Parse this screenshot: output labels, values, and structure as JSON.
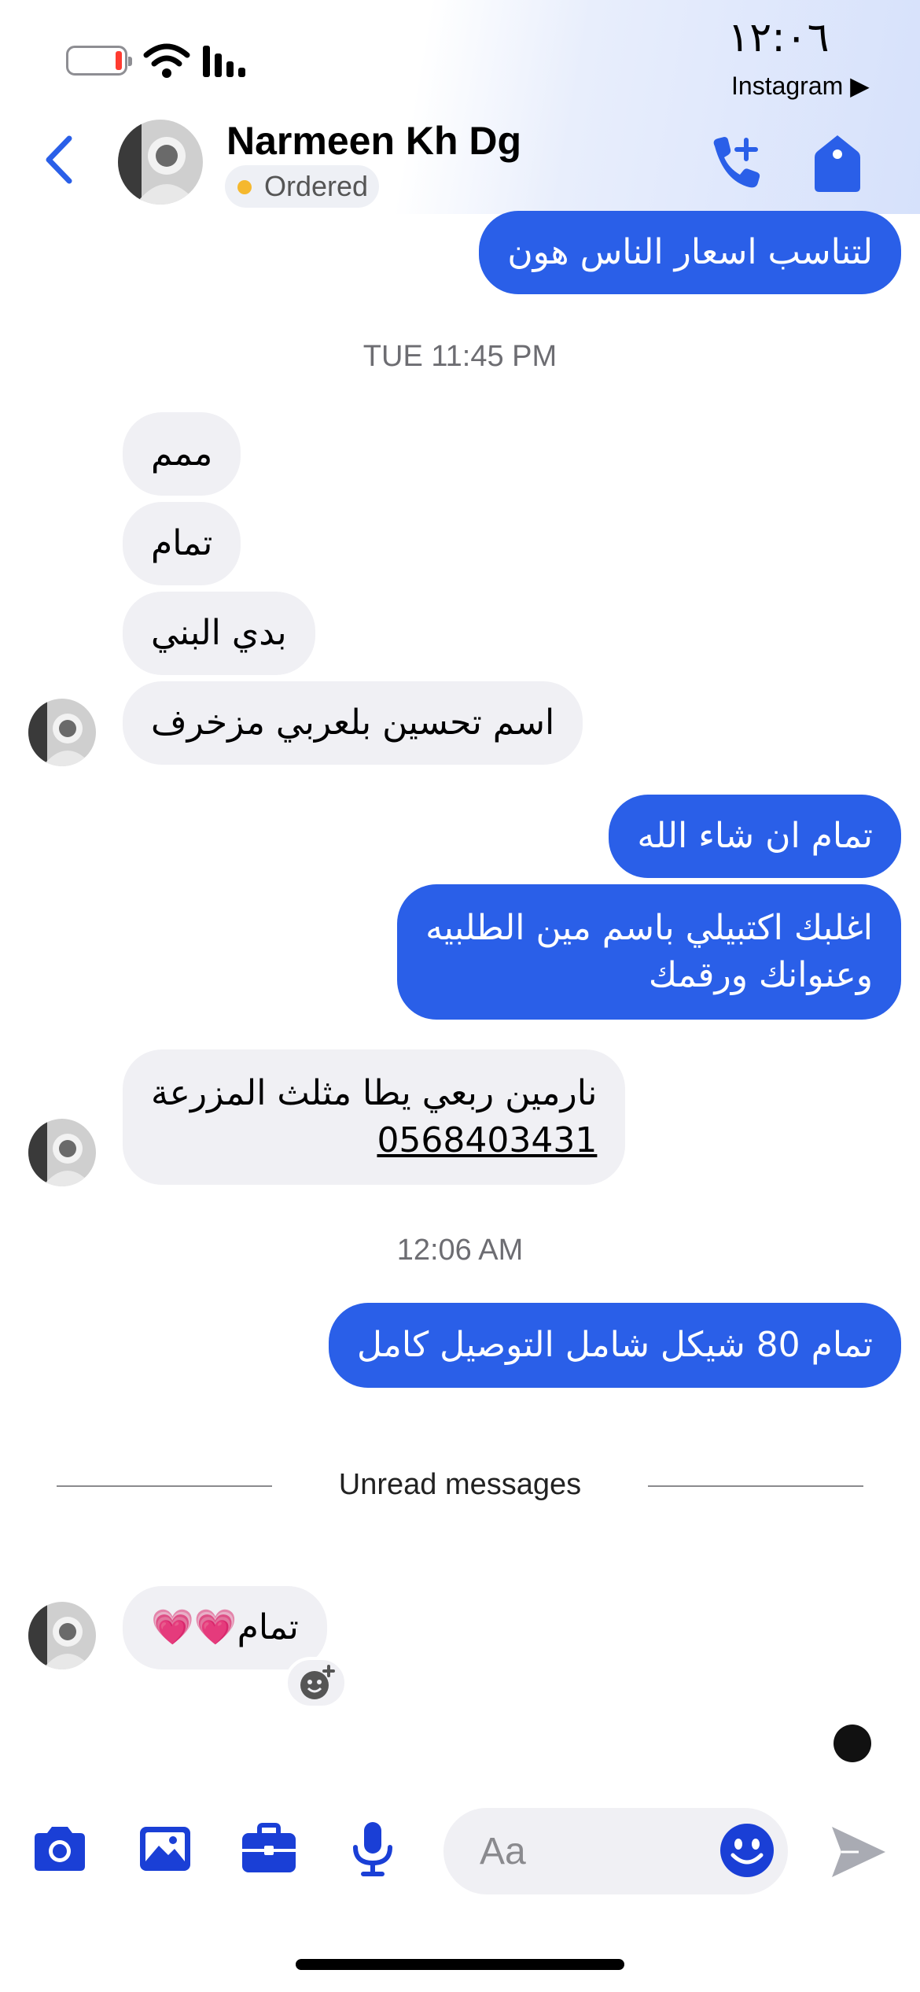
{
  "status_bar": {
    "time": "١٢:٠٦",
    "back_to_app": "Instagram ▶"
  },
  "header": {
    "contact_name": "Narmeen Kh Dg",
    "label": "Ordered",
    "label_color": "#f5b82e",
    "accent": "#2a5fe8"
  },
  "messages": {
    "m1": "لتناسب اسعار الناس هون",
    "ts1": "TUE 11:45 PM",
    "m2": "ممم",
    "m3": "تمام",
    "m4": "بدي البني",
    "m5": "اسم تحسين بلعربي مزخرف",
    "m6": "تمام ان شاء الله",
    "m7_line1": "اغلبك اكتبيلي باسم مين الطلبيه",
    "m7_line2": "وعنوانك ورقمك",
    "m8_line1": "نارمين ربعي يطا مثلث المزرعة",
    "m8_phone": "0568403431",
    "ts2": "12:06 AM",
    "m9": "تمام 80 شيكل شامل التوصيل كامل",
    "unread_label": "Unread messages",
    "m10": "تمام💗💗"
  },
  "composer": {
    "placeholder": "Aa",
    "icons": [
      "camera-icon",
      "gallery-icon",
      "briefcase-icon",
      "microphone-icon",
      "emoji-icon",
      "send-icon"
    ]
  }
}
